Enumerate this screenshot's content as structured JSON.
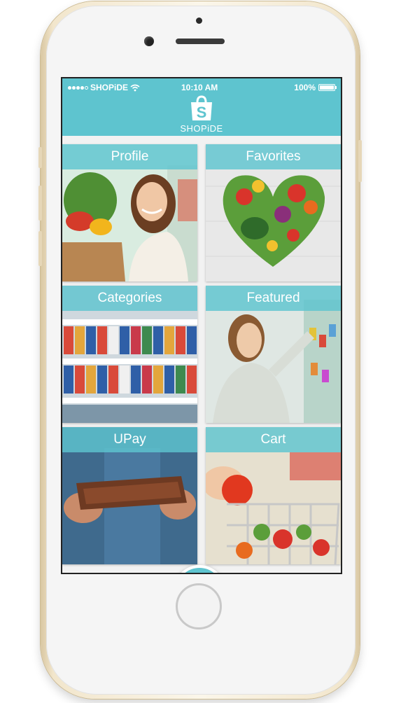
{
  "status_bar": {
    "carrier": "SHOPiDE",
    "time": "10:10 AM",
    "battery": "100%"
  },
  "header": {
    "brand_name": "SHOPiDE",
    "logo_icon": "shopping-bag-s-icon"
  },
  "tiles": [
    {
      "label": "Profile"
    },
    {
      "label": "Favorites"
    },
    {
      "label": "Categories"
    },
    {
      "label": "Featured"
    },
    {
      "label": "UPay"
    },
    {
      "label": "Cart"
    }
  ],
  "fab": {
    "icon": "camera-icon"
  },
  "colors": {
    "accent": "#5ec4cf",
    "frame": "#f2e6cc"
  }
}
